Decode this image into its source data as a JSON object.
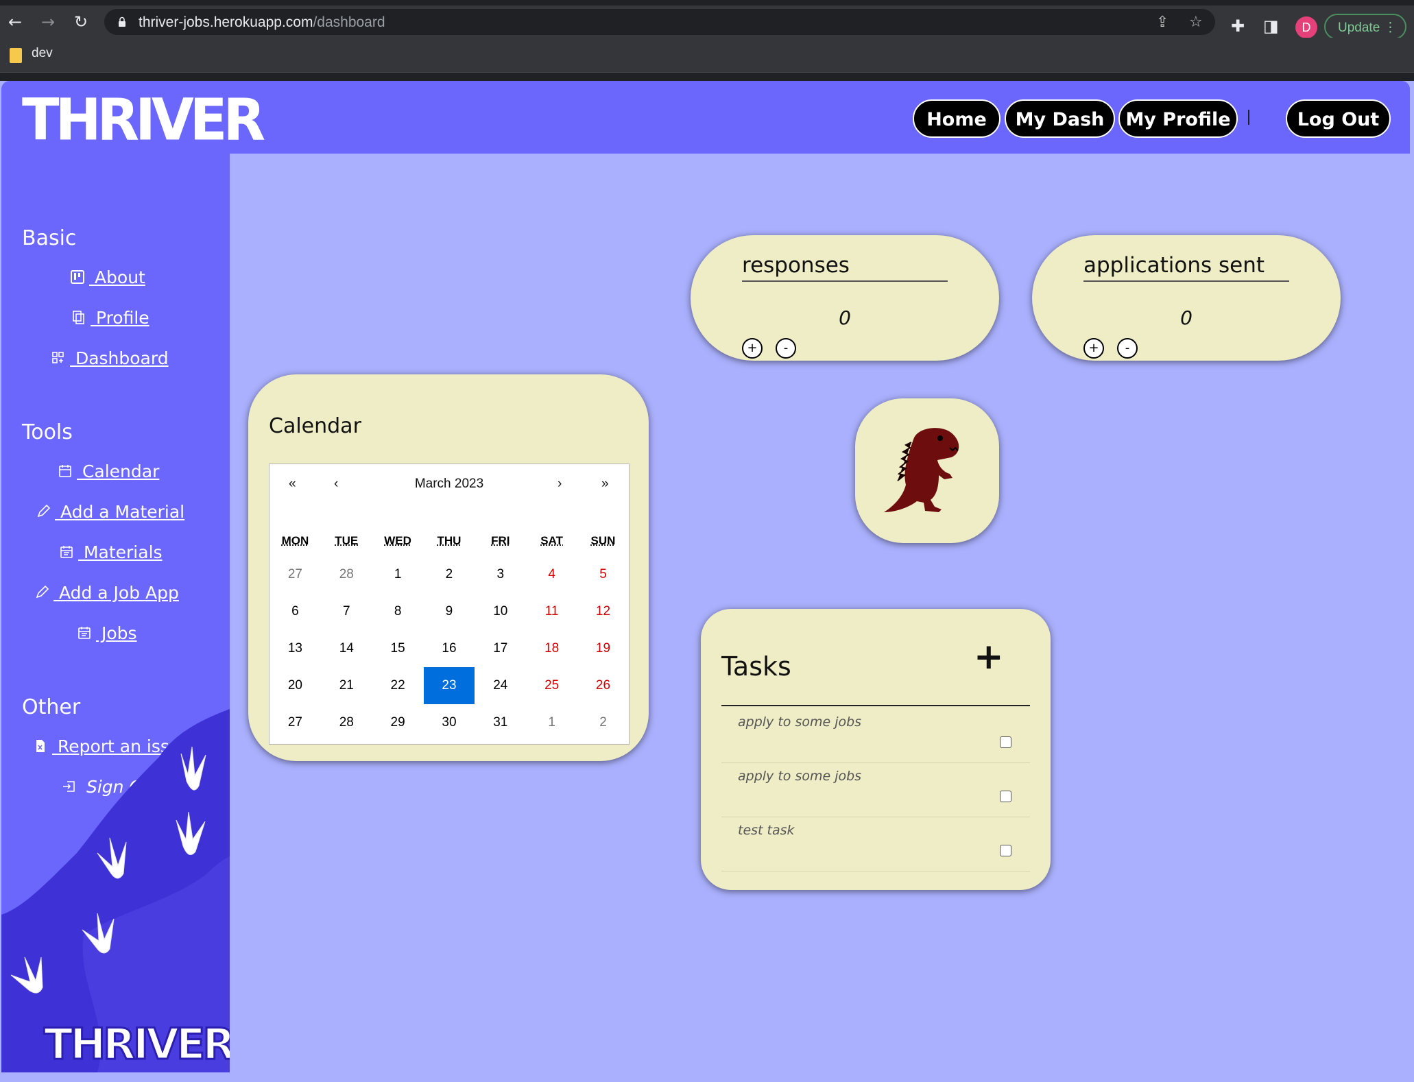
{
  "browser": {
    "url_host": "thriver-jobs.herokuapp.com",
    "url_path": "/dashboard",
    "avatar_letter": "D",
    "update_label": "Update",
    "bookmark_label": "dev"
  },
  "header": {
    "logo": "THRIVER",
    "nav": [
      {
        "label": "Home"
      },
      {
        "label": "My Dash"
      },
      {
        "label": "My Profile"
      }
    ],
    "logout_label": "Log Out"
  },
  "sidebar": {
    "sections": [
      {
        "heading": "Basic",
        "items": [
          {
            "label": " About",
            "icon": "kanban-icon"
          },
          {
            "label": " Profile",
            "icon": "documents-icon"
          },
          {
            "label": " Dashboard",
            "icon": "grid-icon"
          }
        ]
      },
      {
        "heading": "Tools",
        "items": [
          {
            "label": " Calendar",
            "icon": "calendar-icon"
          },
          {
            "label": " Add a Material",
            "icon": "pencil-icon"
          },
          {
            "label": " Materials",
            "icon": "calendar-doc-icon"
          },
          {
            "label": " Add a Job App",
            "icon": "pencil-icon"
          },
          {
            "label": " Jobs",
            "icon": "calendar-doc-icon"
          }
        ]
      },
      {
        "heading": "Other",
        "items": [
          {
            "label": " Report an issue",
            "icon": "file-x-icon"
          },
          {
            "label": " Sign Out",
            "icon": "sign-out-icon"
          }
        ]
      }
    ],
    "bottom_logo": "THRIVER"
  },
  "counters": [
    {
      "title": "responses",
      "value": "0",
      "plus": "+",
      "minus": "-"
    },
    {
      "title": "applications sent",
      "value": "0",
      "plus": "+",
      "minus": "-"
    }
  ],
  "calendar": {
    "title": "Calendar",
    "month_label": "March 2023",
    "nav": {
      "prev_year": "«",
      "prev_month": "‹",
      "next_month": "›",
      "next_year": "»"
    },
    "weekdays": [
      "MON",
      "TUE",
      "WED",
      "THU",
      "FRI",
      "SAT",
      "SUN"
    ],
    "weeks": [
      [
        "27",
        "28",
        "1",
        "2",
        "3",
        "4",
        "5"
      ],
      [
        "6",
        "7",
        "8",
        "9",
        "10",
        "11",
        "12"
      ],
      [
        "13",
        "14",
        "15",
        "16",
        "17",
        "18",
        "19"
      ],
      [
        "20",
        "21",
        "22",
        "23",
        "24",
        "25",
        "26"
      ],
      [
        "27",
        "28",
        "29",
        "30",
        "31",
        "1",
        "2"
      ]
    ],
    "selected_day": "23"
  },
  "tasks": {
    "title": "Tasks",
    "add_label": "+",
    "items": [
      {
        "text": "apply to some jobs",
        "done": false
      },
      {
        "text": "apply to some jobs",
        "done": false
      },
      {
        "text": "test task",
        "done": false
      }
    ]
  },
  "colors": {
    "brand_purple": "#6b67fd",
    "page_lavender": "#aab0fd",
    "card_cream": "#efedc6",
    "selected_blue": "#006edc",
    "weekend_red": "#d10000",
    "dino_red": "#6e0d0d"
  }
}
